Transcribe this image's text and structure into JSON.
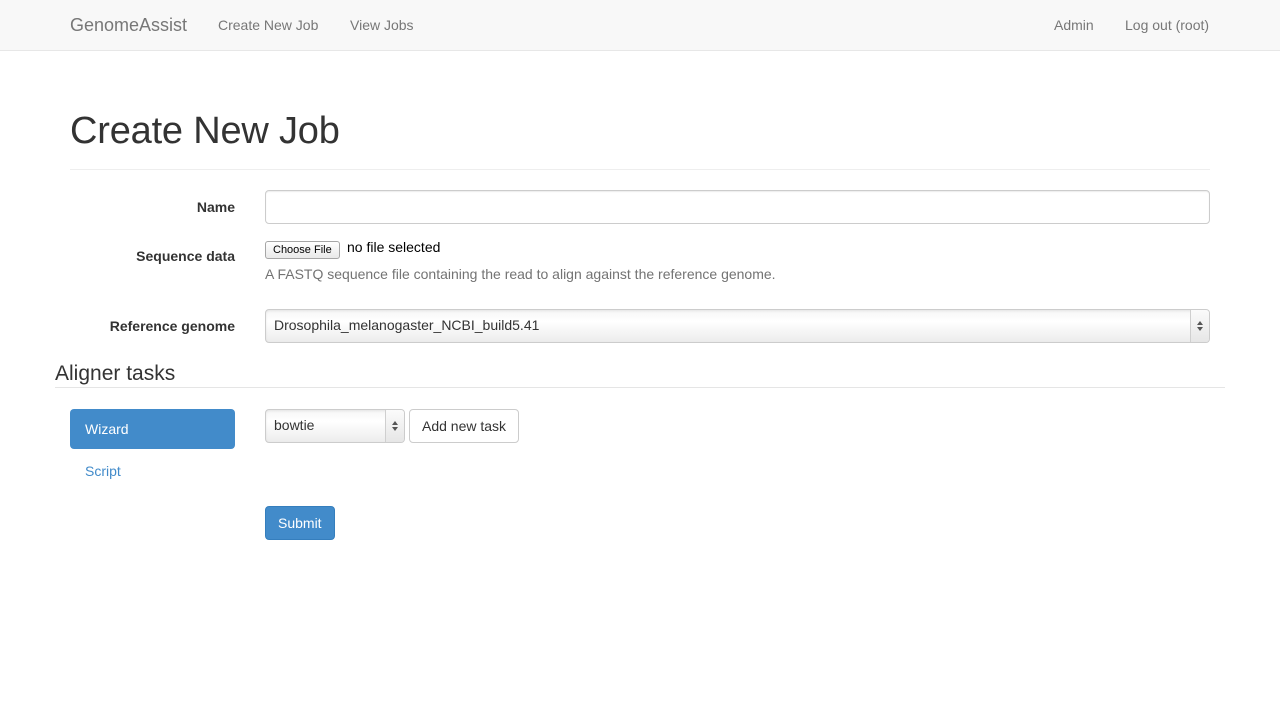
{
  "navbar": {
    "brand": "GenomeAssist",
    "links": [
      "Create New Job",
      "View Jobs"
    ],
    "right_links": [
      "Admin",
      "Log out (root)"
    ]
  },
  "page": {
    "title": "Create New Job"
  },
  "form": {
    "name_label": "Name",
    "name_value": "",
    "sequence_label": "Sequence data",
    "file_button_label": "Choose File",
    "file_status": "no file selected",
    "sequence_help": "A FASTQ sequence file containing the read to align against the reference genome.",
    "reference_label": "Reference genome",
    "reference_value": "Drosophila_melanogaster_NCBI_build5.41"
  },
  "aligner": {
    "section_title": "Aligner tasks",
    "tabs": [
      "Wizard",
      "Script"
    ],
    "active_tab": "Wizard",
    "task_select_value": "bowtie",
    "add_task_label": "Add new task"
  },
  "submit_label": "Submit",
  "colors": {
    "primary": "#428bca",
    "navbar_bg": "#f8f8f8",
    "nav_text": "#777777"
  }
}
